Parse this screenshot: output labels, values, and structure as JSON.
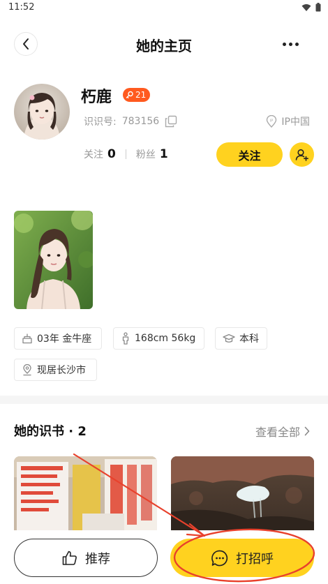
{
  "status": {
    "time": "11:52"
  },
  "nav": {
    "title": "她的主页"
  },
  "profile": {
    "nickname": "朽鹿",
    "level": "21",
    "id_label": "识识号:",
    "id_value": "783156",
    "ip_label": "IP中国",
    "following_label": "关注",
    "following_count": "0",
    "fans_label": "粉丝",
    "fans_count": "1",
    "follow_button": "关注"
  },
  "tags": [
    {
      "icon": "age-icon",
      "label": "03年 金牛座"
    },
    {
      "icon": "height-weight-icon",
      "label": "168cm 56kg"
    },
    {
      "icon": "graduation-cap-icon",
      "label": "本科"
    },
    {
      "icon": "location-pin-icon",
      "label": "现居长沙市"
    }
  ],
  "books": {
    "title": "她的识书 · 2",
    "view_all": "查看全部"
  },
  "bottom": {
    "recommend": "推荐",
    "greet": "打招呼"
  },
  "colors": {
    "accent": "#ffd21f",
    "badge": "#ff5a1f",
    "annotation": "#e8412c"
  }
}
